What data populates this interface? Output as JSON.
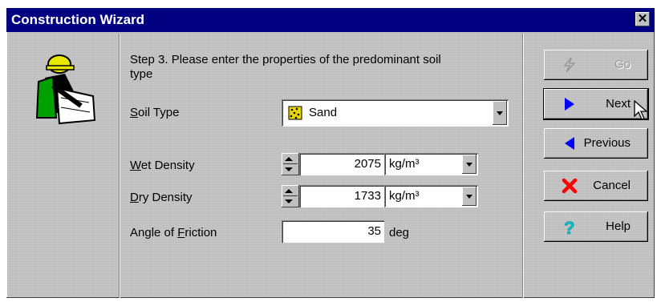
{
  "window": {
    "title": "Construction Wizard"
  },
  "step_text": "Step 3. Please enter the properties of the predominant soil type",
  "soil_type": {
    "label": "Soil Type",
    "label_accel": "S",
    "label_rest": "oil Type",
    "value": "Sand",
    "icon": "sand-icon"
  },
  "wet_density": {
    "label_accel": "W",
    "label_rest": "et Density",
    "value": "2075",
    "unit": "kg/m³"
  },
  "dry_density": {
    "label_accel": "D",
    "label_rest": "ry Density",
    "value": "1733",
    "unit": "kg/m³"
  },
  "friction": {
    "label_pre": "Angle of ",
    "label_accel": "F",
    "label_rest": "riction",
    "value": "35",
    "unit": "deg"
  },
  "buttons": {
    "go": "Go",
    "next": "Next",
    "previous": "Previous",
    "cancel": "Cancel",
    "help": "Help"
  },
  "colors": {
    "title_bar": "#000080",
    "arrow_blue": "#0000ff",
    "cancel_red": "#ff0000",
    "help_cyan": "#00c8d8"
  }
}
